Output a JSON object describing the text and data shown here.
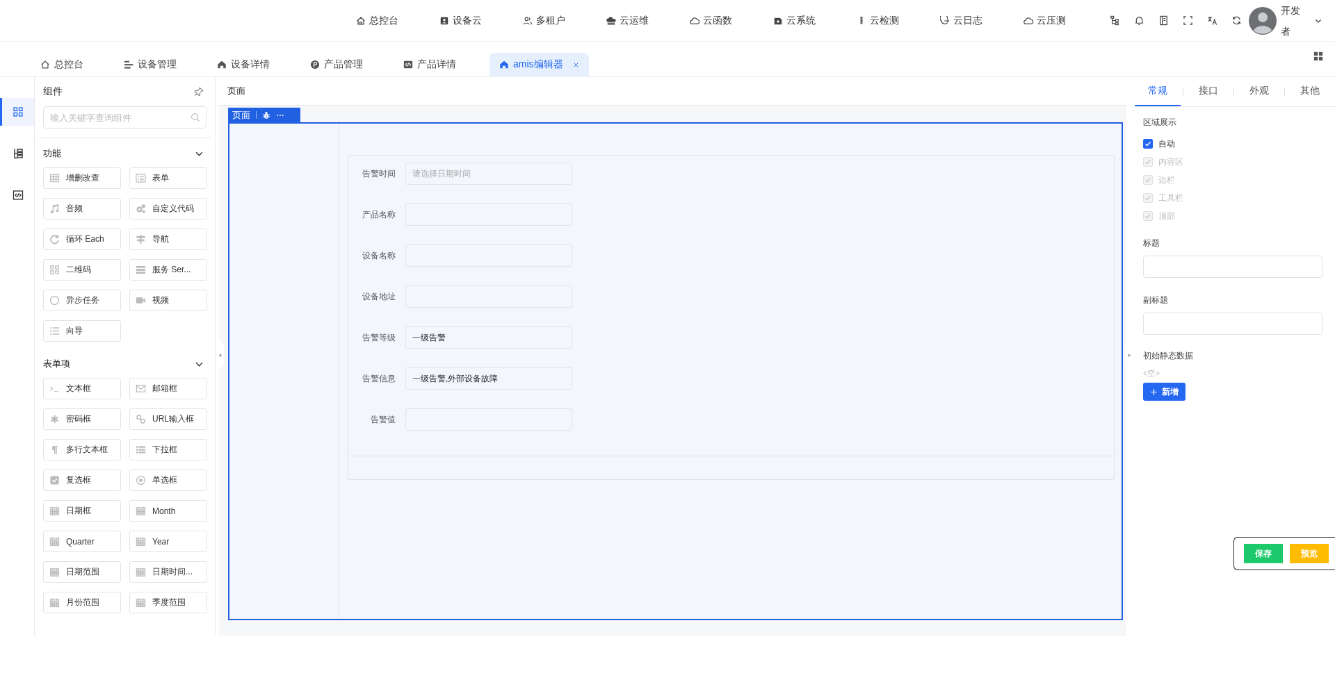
{
  "top_nav": [
    {
      "label": "总控台"
    },
    {
      "label": "设备云"
    },
    {
      "label": "多租户"
    },
    {
      "label": "云运维"
    },
    {
      "label": "云函数"
    },
    {
      "label": "云系统"
    },
    {
      "label": "云检测"
    },
    {
      "label": "云日志"
    },
    {
      "label": "云压测"
    }
  ],
  "user": {
    "name": "开发者"
  },
  "tabs": [
    {
      "label": "总控台",
      "selected": false
    },
    {
      "label": "设备管理",
      "selected": false
    },
    {
      "label": "设备详情",
      "selected": false
    },
    {
      "label": "产品管理",
      "selected": false
    },
    {
      "label": "产品详情",
      "selected": false
    },
    {
      "label": "amis编辑器",
      "selected": true
    }
  ],
  "left_rail": [
    {
      "selected": true
    },
    {
      "selected": false
    },
    {
      "selected": false
    }
  ],
  "component_panel": {
    "title": "组件",
    "search_placeholder": "输入关键字查询组件",
    "groups": [
      {
        "title": "功能",
        "expanded": true,
        "items": [
          "增删改查",
          "表单",
          "音频",
          "自定义代码",
          "循环 Each",
          "导航",
          "二维码",
          "服务 Ser...",
          "异步任务",
          "视频",
          "向导"
        ]
      },
      {
        "title": "表单项",
        "expanded": true,
        "items": [
          "文本框",
          "邮箱框",
          "密码框",
          "URL输入框",
          "多行文本框",
          "下拉框",
          "复选框",
          "单选框",
          "日期框",
          "Month",
          "Quarter",
          "Year",
          "日期范围",
          "日期时间...",
          "月份范围",
          "季度范围"
        ]
      }
    ]
  },
  "canvas": {
    "breadcrumb": "页面",
    "toolbar_label": "页面",
    "fields": [
      {
        "label": "告警时间",
        "placeholder": "请选择日期时间"
      },
      {
        "label": "产品名称"
      },
      {
        "label": "设备名称"
      },
      {
        "label": "设备地址"
      },
      {
        "label": "告警等级",
        "value": "一级告警"
      },
      {
        "label": "告警信息",
        "value": "一级告警,外部设备故障"
      },
      {
        "label": "告警值"
      }
    ]
  },
  "settings_panel": {
    "tabs": [
      {
        "label": "常规",
        "selected": true
      },
      {
        "label": "接口",
        "selected": false
      },
      {
        "label": "外观",
        "selected": false
      },
      {
        "label": "其他",
        "selected": false
      }
    ],
    "region_title": "区域展示",
    "regions": [
      {
        "label": "自动",
        "checked": true,
        "disabled": false
      },
      {
        "label": "内容区",
        "checked": true,
        "disabled": true
      },
      {
        "label": "边栏",
        "checked": true,
        "disabled": true
      },
      {
        "label": "工具栏",
        "checked": true,
        "disabled": true
      },
      {
        "label": "顶部",
        "checked": true,
        "disabled": true
      }
    ],
    "fields": [
      {
        "label": "标题"
      },
      {
        "label": "副标题"
      }
    ],
    "static_data": {
      "label": "初始静态数据",
      "empty": "<空>",
      "add_button": "新增"
    }
  },
  "actions": [
    {
      "label": "保存",
      "kind": "save"
    },
    {
      "label": "预览",
      "kind": "preview"
    }
  ]
}
